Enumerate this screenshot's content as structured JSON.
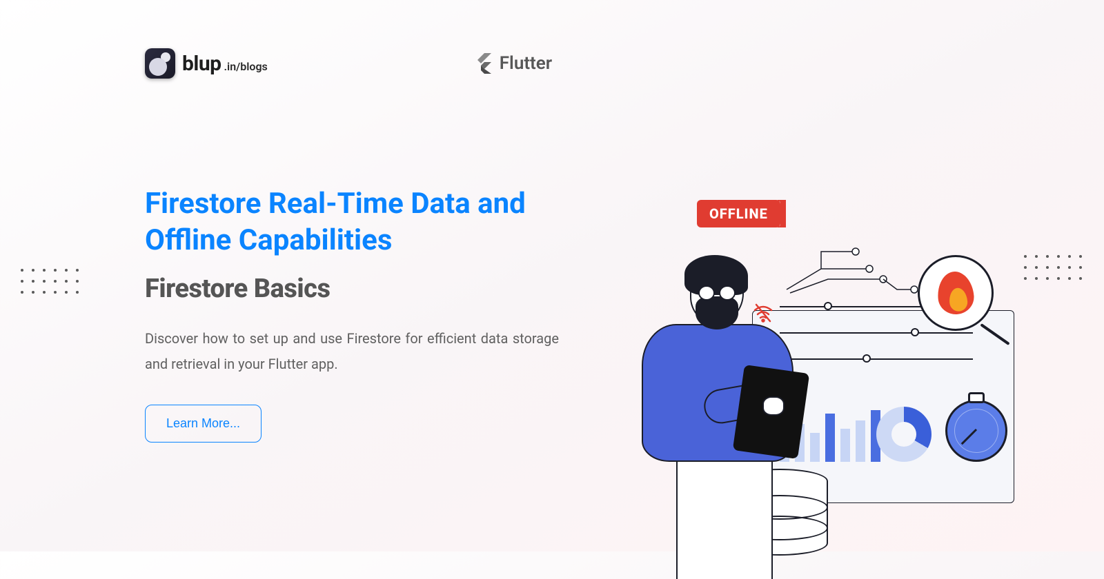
{
  "header": {
    "logo_word": "blup",
    "logo_suffix": ".in/blogs",
    "secondary_label": "Flutter"
  },
  "hero": {
    "title": "Firestore Real-Time Data and Offline Capabilities",
    "subtitle": "Firestore Basics",
    "description": "Discover how to set up and use Firestore for efficient data storage and retrieval in your Flutter app.",
    "cta_label": "Learn More..."
  },
  "illustration": {
    "badge_text": "OFFLINE"
  },
  "colors": {
    "accent": "#0a84ff",
    "badge": "#e03c31",
    "person_shirt": "#4a63d8"
  }
}
